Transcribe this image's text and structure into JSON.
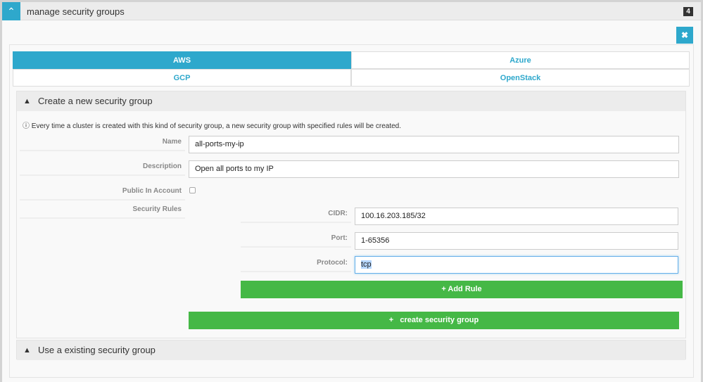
{
  "header": {
    "title": "manage security groups",
    "badge": "4",
    "toggle_icon": "chevron-up-icon",
    "close_icon": "close-icon"
  },
  "tabs": [
    {
      "label": "AWS",
      "active": true
    },
    {
      "label": "Azure"
    },
    {
      "label": "GCP"
    },
    {
      "label": "OpenStack"
    }
  ],
  "create": {
    "title": "Create a new security group",
    "info": "Every time a cluster is created with this kind of security group, a new security group with specified rules will be created.",
    "name_label": "Name",
    "name_value": "all-ports-my-ip",
    "description_label": "Description",
    "description_value": "Open all ports to my IP",
    "public_label": "Public In Account",
    "public_checked": false,
    "rules_label": "Security Rules",
    "cidr_label": "CIDR:",
    "cidr_value": "100.16.203.185/32",
    "port_label": "Port:",
    "port_value": "1-65356",
    "protocol_label": "Protocol:",
    "protocol_value": "tcp",
    "add_rule": "Add Rule",
    "create_button": "create security group"
  },
  "existing": {
    "title": "Use a existing security group"
  },
  "colors": {
    "accent": "#2ea8cc",
    "success": "#45b846"
  }
}
